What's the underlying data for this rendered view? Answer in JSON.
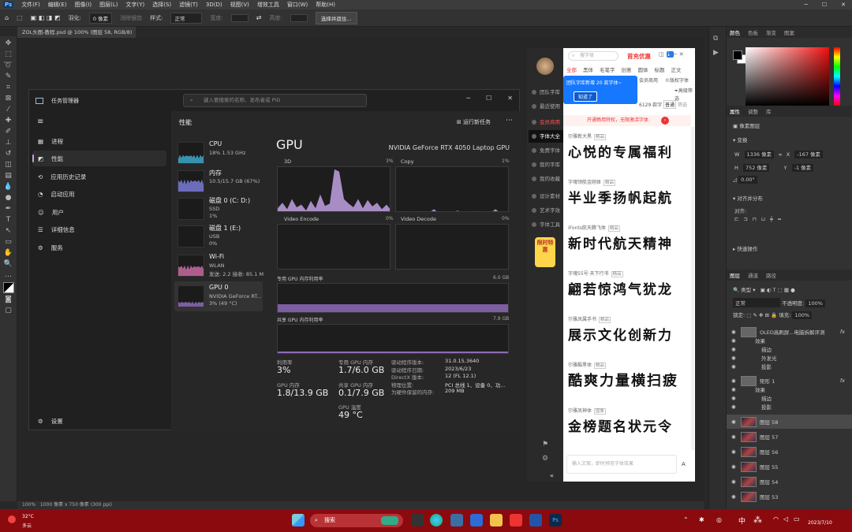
{
  "ps": {
    "menu": [
      "文件(F)",
      "编辑(E)",
      "图像(I)",
      "图层(L)",
      "文字(Y)",
      "选择(S)",
      "滤镜(T)",
      "3D(D)",
      "视图(V)",
      "增效工具",
      "窗口(W)",
      "帮助(H)"
    ],
    "options": {
      "feather_label": "羽化:",
      "feather_value": "0 像素",
      "antialias": "消除锯齿",
      "style_label": "样式:",
      "style_value": "正常",
      "width_label": "宽度:",
      "height_label": "高度:",
      "select_mask_btn": "选择并遮住..."
    },
    "doc_tab": "ZOL头图-教程.psd @ 100% (图层 58, RGB/8)",
    "status": {
      "zoom": "100%",
      "doc_size": "1000 像素 x 750 像素 (300 ppi)"
    },
    "panels": {
      "color_tabs": [
        "颜色",
        "色板",
        "渐变",
        "图案"
      ],
      "props_tabs": [
        "属性",
        "调整",
        "库"
      ],
      "props_title": "像素图层",
      "transform_label": "变换",
      "w_label": "W",
      "w_value": "1336 像素",
      "x_label": "X",
      "x_value": "-167 像素",
      "h_label": "H",
      "h_value": "752 像素",
      "y_label": "Y",
      "y_value": "-1 像素",
      "rotate_value": "0.00°",
      "align_label": "对齐并分布",
      "align_sub": "对齐:",
      "quick_actions": "快速操作",
      "layers_tabs": [
        "图层",
        "通道",
        "路径"
      ],
      "layer_kind": "类型",
      "blend_mode": "正常",
      "opacity_label": "不透明度:",
      "opacity_value": "100%",
      "lock_label": "锁定:",
      "fill_label": "填充:",
      "fill_value": "100%",
      "layers": [
        "OLED高刷屏...电脑拆解评测",
        "效果",
        "描边",
        "外发光",
        "投影",
        "矩形 1",
        "效果",
        "描边",
        "投影",
        "图层 58",
        "图层 57",
        "图层 56",
        "图层 55",
        "图层 54",
        "图层 53"
      ]
    }
  },
  "tm": {
    "title": "任务管理器",
    "search_placeholder": "键入要搜索的名称、发布者或 PID",
    "nav": [
      "进程",
      "性能",
      "应用历史记录",
      "启动应用",
      "用户",
      "详细信息",
      "服务"
    ],
    "settings": "设置",
    "section": "性能",
    "run_task": "运行新任务",
    "cards": [
      {
        "name": "CPU",
        "l2": "18% 1.53 GHz",
        "l3": ""
      },
      {
        "name": "内存",
        "l2": "10.5/15.7 GB (67%)",
        "l3": ""
      },
      {
        "name": "磁盘 0 (C: D:)",
        "l2": "SSD",
        "l3": "1%"
      },
      {
        "name": "磁盘 1 (E:)",
        "l2": "USB",
        "l3": "0%"
      },
      {
        "name": "Wi-Fi",
        "l2": "WLAN",
        "l3": "发送: 2.2 接收: 85.1 M"
      },
      {
        "name": "GPU 0",
        "l2": "NVIDIA GeForce RT...",
        "l3": "3% (49 °C)"
      }
    ],
    "gpu": {
      "title": "GPU",
      "model": "NVIDIA GeForce RTX 4050 Laptop GPU",
      "graphs": [
        {
          "label": "3D",
          "pct": "3%"
        },
        {
          "label": "Copy",
          "pct": "1%"
        },
        {
          "label": "Video Encode",
          "pct": "0%"
        },
        {
          "label": "Video Decode",
          "pct": "0%"
        }
      ],
      "dedicated_label": "专用 GPU 内存利用率",
      "dedicated_max": "6.0 GB",
      "shared_label": "共享 GPU 内存利用率",
      "shared_max": "7.9 GB",
      "stats": {
        "util_label": "利用率",
        "util_value": "3%",
        "gpumem_label": "GPU 内存",
        "gpumem_value": "1.8/13.9 GB",
        "dedmem_label": "专用 GPU 内存",
        "dedmem_value": "1.7/6.0 GB",
        "shmem_label": "共享 GPU 内存",
        "shmem_value": "0.1/7.9 GB",
        "temp_label": "GPU 温度",
        "temp_value": "49 °C"
      },
      "info": [
        {
          "k": "驱动程序版本:",
          "v": "31.0.15.3640"
        },
        {
          "k": "驱动程序日期:",
          "v": "2023/6/23"
        },
        {
          "k": "DirectX 版本:",
          "v": "12 (FL 12.1)"
        },
        {
          "k": "物理位置:",
          "v": "PCI 总线 1、设备 0、功..."
        },
        {
          "k": "为硬件保留的内存:",
          "v": "209 MB"
        }
      ]
    }
  },
  "fontapp": {
    "search_placeholder": "搜字体",
    "promo": "首充优惠",
    "tabs": [
      "全部",
      "黑体",
      "毛笔字",
      "创意",
      "圆体",
      "标题",
      "正文"
    ],
    "side_nav": [
      "团队字库",
      "最近使用",
      "会员商用",
      "字体大全",
      "免费字体",
      "我的字库",
      "我的收藏",
      "设计素材",
      "艺术字效",
      "字体工具"
    ],
    "tooltip_text": "团队字库新增 20 款字体~",
    "tooltip_btn": "知道了",
    "filter1": "会员商用",
    "filter2": "版权字体",
    "filter3": "高级筛选",
    "count_text": "6129 款字",
    "sort_common": "普通",
    "sort_filter": "筛选",
    "banner": "开通畅用特权，无限激活字体",
    "badge": "限时特惠",
    "samples": [
      {
        "label": "尔雅新大黑",
        "tag": "精品",
        "text": "心悦的专属福利"
      },
      {
        "label": "字魂领航金刚体",
        "tag": "精品",
        "text": "半业季扬帆起航"
      },
      {
        "label": "iFonts航天腾飞体",
        "tag": "精品",
        "text": "新时代航天精神"
      },
      {
        "label": "字魂55号·天下行书",
        "tag": "精品",
        "text": "翩若惊鸿气犹龙"
      },
      {
        "label": "尔雅凤属手书",
        "tag": "精品",
        "text": "展示文化创新力"
      },
      {
        "label": "尔雅酷黑体",
        "tag": "精品",
        "text": "酷爽力量横扫疲"
      },
      {
        "label": "尔雅凤神体",
        "tag": "国象",
        "text": "金榜题名状元令"
      }
    ],
    "input_placeholder": "输入文案，即时预览字体效果",
    "input_suffix": "A"
  },
  "taskbar": {
    "weather_temp": "32°C",
    "weather_desc": "多云",
    "search": "搜索",
    "tray_lang": "中",
    "time": "",
    "date": "2023/7/10"
  },
  "colors": {
    "accent_purple": "#b89ad8",
    "taskbar_red": "#8a0a0e",
    "tooltip_blue": "#1677ff",
    "promo_red": "#e33333"
  }
}
